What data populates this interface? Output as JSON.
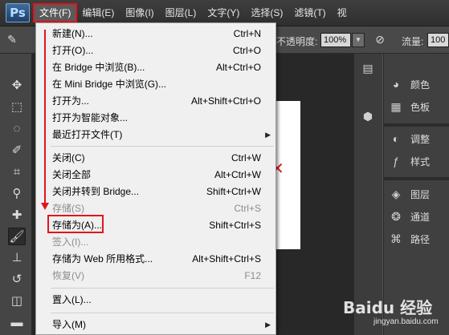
{
  "app": {
    "logo": "Ps"
  },
  "menubar": {
    "items": [
      {
        "label": "文件(F)",
        "active": true
      },
      {
        "label": "编辑(E)"
      },
      {
        "label": "图像(I)"
      },
      {
        "label": "图层(L)"
      },
      {
        "label": "文字(Y)"
      },
      {
        "label": "选择(S)"
      },
      {
        "label": "滤镜(T)"
      },
      {
        "label": "视"
      }
    ]
  },
  "options_bar": {
    "opacity_label": "不透明度:",
    "opacity_value": "100%",
    "flow_label": "流量:",
    "flow_value": "100"
  },
  "file_menu": {
    "items": [
      {
        "label": "新建(N)...",
        "shortcut": "Ctrl+N"
      },
      {
        "label": "打开(O)...",
        "shortcut": "Ctrl+O"
      },
      {
        "label": "在 Bridge 中浏览(B)...",
        "shortcut": "Alt+Ctrl+O"
      },
      {
        "label": "在 Mini Bridge 中浏览(G)...",
        "shortcut": ""
      },
      {
        "label": "打开为...",
        "shortcut": "Alt+Shift+Ctrl+O"
      },
      {
        "label": "打开为智能对象...",
        "shortcut": ""
      },
      {
        "label": "最近打开文件(T)",
        "shortcut": "",
        "submenu": true
      },
      {
        "label": "关闭(C)",
        "shortcut": "Ctrl+W"
      },
      {
        "label": "关闭全部",
        "shortcut": "Alt+Ctrl+W"
      },
      {
        "label": "关闭并转到 Bridge...",
        "shortcut": "Shift+Ctrl+W"
      },
      {
        "label": "存储(S)",
        "shortcut": "Ctrl+S",
        "disabled": true
      },
      {
        "label": "存储为(A)...",
        "shortcut": "Shift+Ctrl+S",
        "highlighted": true
      },
      {
        "label": "签入(I)...",
        "shortcut": "",
        "disabled": true
      },
      {
        "label": "存储为 Web 所用格式...",
        "shortcut": "Alt+Shift+Ctrl+S"
      },
      {
        "label": "恢复(V)",
        "shortcut": "F12",
        "disabled": true
      },
      {
        "label": "置入(L)...",
        "shortcut": ""
      },
      {
        "label": "导入(M)",
        "shortcut": "",
        "submenu": true
      }
    ]
  },
  "panels": {
    "items": [
      {
        "label": "颜色",
        "icon": "color-palette-icon"
      },
      {
        "label": "色板",
        "icon": "swatches-icon"
      },
      {
        "label": "调整",
        "icon": "adjustments-icon"
      },
      {
        "label": "样式",
        "icon": "styles-icon"
      },
      {
        "label": "图层",
        "icon": "layers-icon"
      },
      {
        "label": "通道",
        "icon": "channels-icon"
      },
      {
        "label": "路径",
        "icon": "paths-icon"
      }
    ]
  },
  "watermark": {
    "brand": "Baidu 经验",
    "url": "jingyan.baidu.com"
  },
  "colors": {
    "highlight_red": "#e3141b",
    "menu_bg": "#f0f0f0",
    "app_bg": "#535353"
  }
}
